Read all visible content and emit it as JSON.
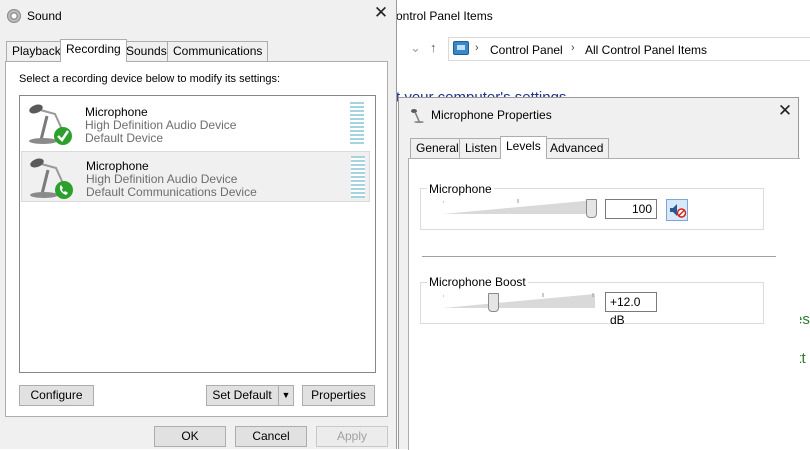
{
  "control_panel": {
    "title": "ontrol Panel Items",
    "breadcrumb": [
      "Control Panel",
      "All Control Panel Items"
    ],
    "heading": "t your computer's settings",
    "side_letters": [
      "es",
      "kt"
    ]
  },
  "sound": {
    "title": "Sound",
    "tabs": [
      "Playback",
      "Recording",
      "Sounds",
      "Communications"
    ],
    "active_tab": "Recording",
    "instruction": "Select a recording device below to modify its settings:",
    "devices": [
      {
        "name": "Microphone",
        "driver": "High Definition Audio Device",
        "status": "Default Device",
        "badge": "check"
      },
      {
        "name": "Microphone",
        "driver": "High Definition Audio Device",
        "status": "Default Communications Device",
        "badge": "phone"
      }
    ],
    "buttons": {
      "configure": "Configure",
      "set_default": "Set Default",
      "properties": "Properties",
      "ok": "OK",
      "cancel": "Cancel",
      "apply": "Apply"
    }
  },
  "props": {
    "title": "Microphone Properties",
    "tabs": [
      "General",
      "Listen",
      "Levels",
      "Advanced"
    ],
    "active_tab": "Levels",
    "microphone": {
      "label": "Microphone",
      "value": "100",
      "level_fraction": 1.0,
      "muted": false
    },
    "boost": {
      "label": "Microphone Boost",
      "value": "+12.0 dB",
      "level_fraction": 0.333
    }
  },
  "colors": {
    "badge_green": "#2ca02c",
    "meter": "#a6d3e0",
    "link_blue": "#1e3287"
  }
}
